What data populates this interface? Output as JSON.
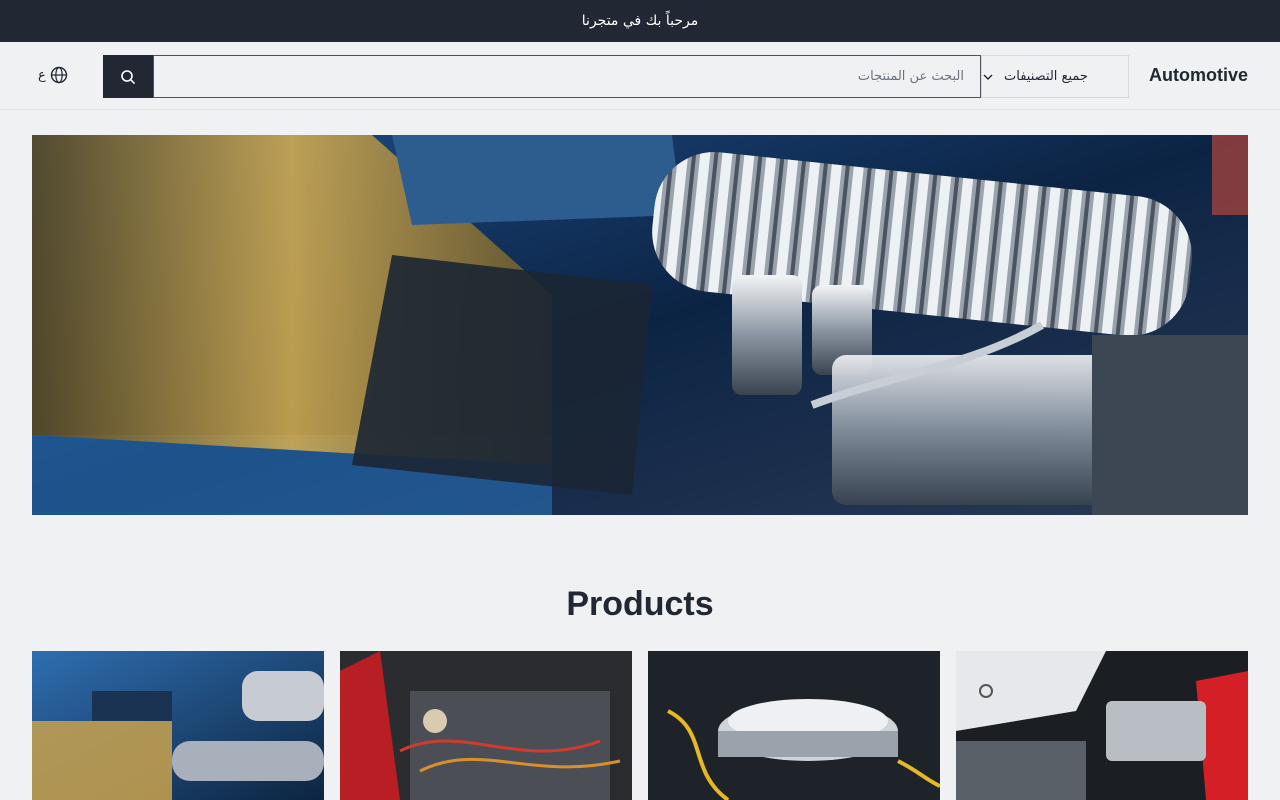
{
  "announcement": "مرحباً بك في متجرنا",
  "header": {
    "brand": "Automotive",
    "category_select": "جميع التصنيفات",
    "search_placeholder": "البحث عن المنتجات",
    "language_label": "ع"
  },
  "hero": {
    "image": "engine-chrome-closeup"
  },
  "products": {
    "title": "Products",
    "items": [
      {
        "image": "blue-engine-chrome"
      },
      {
        "image": "red-car-engine-bay"
      },
      {
        "image": "chrome-air-filter-engine"
      },
      {
        "image": "audi-engine-bay"
      }
    ]
  },
  "colors": {
    "dark": "#212833",
    "background": "#f0f1f3"
  }
}
